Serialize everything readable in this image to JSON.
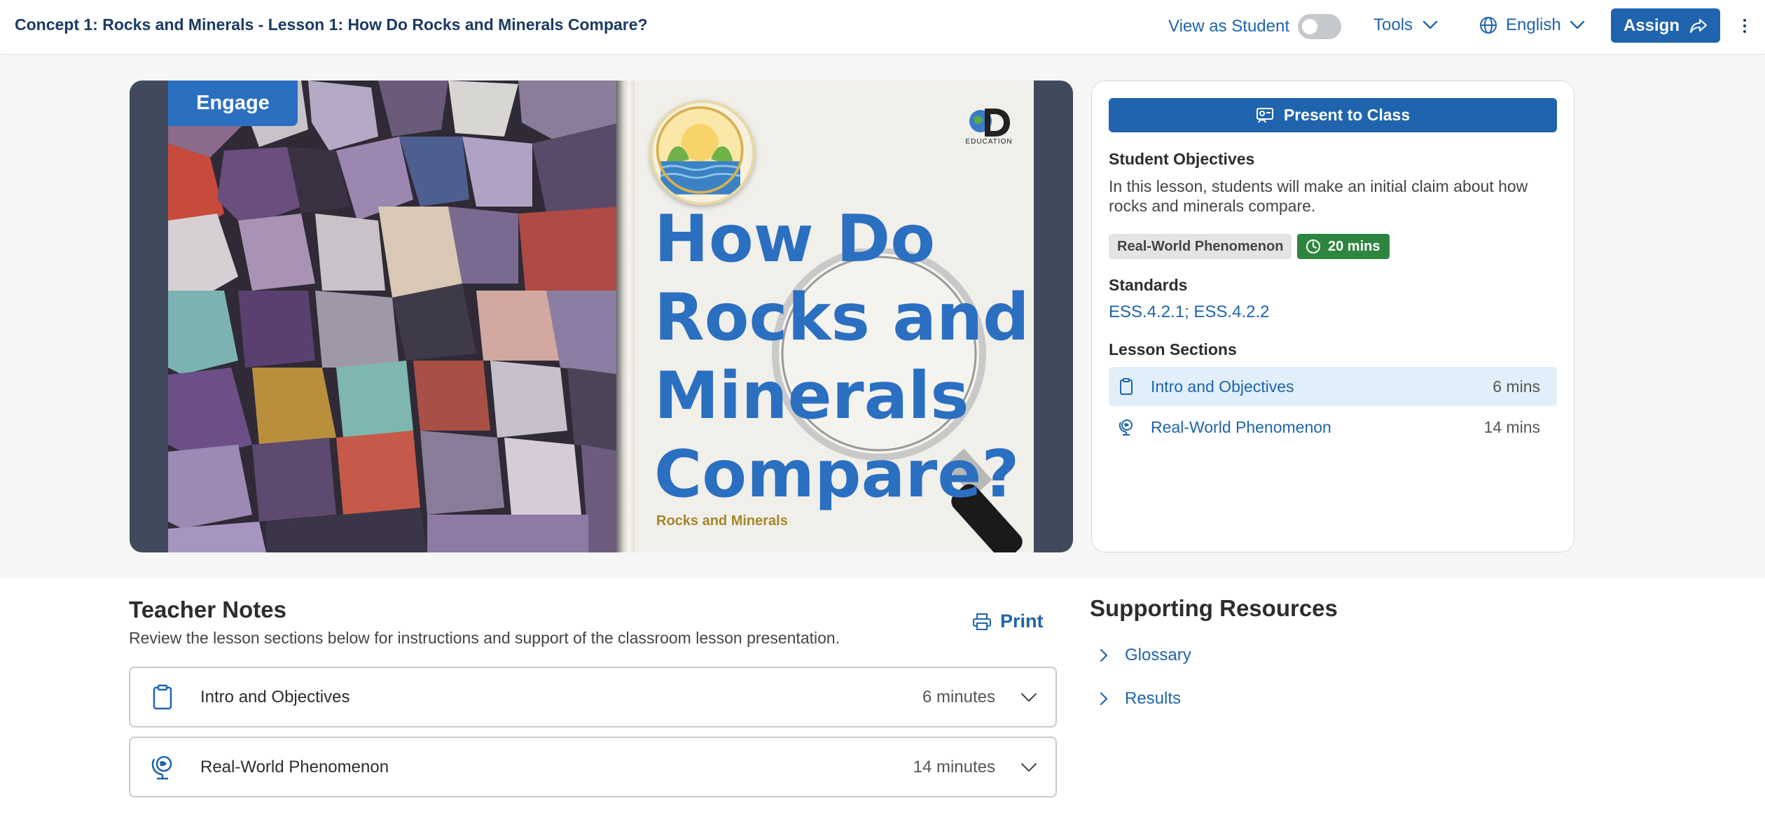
{
  "header": {
    "title": "Concept 1: Rocks and Minerals - Lesson 1: How Do Rocks and Minerals Compare?",
    "view_as_student": "View as Student",
    "view_as_student_enabled": false,
    "tools": "Tools",
    "language": "English",
    "assign": "Assign"
  },
  "slide": {
    "tag": "Engage",
    "heading_lines": [
      "How Do",
      "Rocks and",
      "Minerals",
      "Compare?"
    ],
    "subtitle": "Rocks and Minerals",
    "brand": "EDUCATION"
  },
  "info": {
    "present_button": "Present to Class",
    "objectives_heading": "Student Objectives",
    "objectives_text": "In this lesson, students will make an initial claim about how rocks and minerals compare.",
    "tag_type": "Real-World Phenomenon",
    "tag_time": "20 mins",
    "standards_heading": "Standards",
    "standards_links": "ESS.4.2.1; ESS.4.2.2",
    "sections_heading": "Lesson Sections",
    "sections": [
      {
        "label": "Intro and Objectives",
        "time": "6 mins",
        "icon": "clipboard-icon",
        "active": true
      },
      {
        "label": "Real-World Phenomenon",
        "time": "14 mins",
        "icon": "globe-pin-icon",
        "active": false
      }
    ]
  },
  "teacher_notes": {
    "title": "Teacher Notes",
    "description": "Review the lesson sections below for instructions and support of the classroom lesson presentation.",
    "print": "Print",
    "items": [
      {
        "label": "Intro and Objectives",
        "time": "6 minutes",
        "icon": "clipboard-icon"
      },
      {
        "label": "Real-World Phenomenon",
        "time": "14 minutes",
        "icon": "globe-pin-icon"
      }
    ]
  },
  "supporting_resources": {
    "title": "Supporting Resources",
    "items": [
      "Glossary",
      "Results"
    ]
  },
  "colors": {
    "primary": "#1f64ad",
    "slide_blue": "#2b6fc1",
    "success": "#2e8540",
    "frame": "#404a5c"
  }
}
